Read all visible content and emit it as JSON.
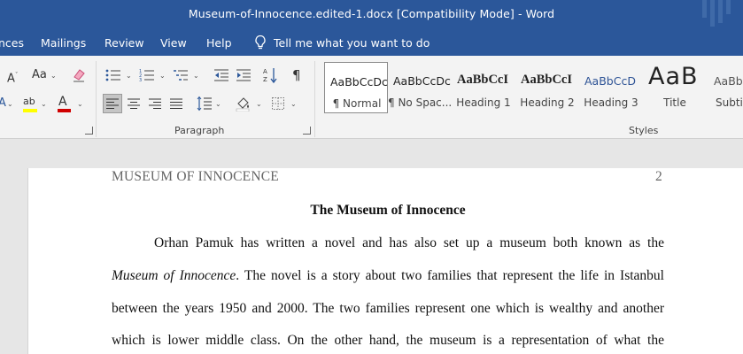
{
  "window": {
    "title": "Museum-of-Innocence.edited-1.docx [Compatibility Mode]  -  Word"
  },
  "menu": {
    "tabs": [
      "nces",
      "Mailings",
      "Review",
      "View",
      "Help"
    ],
    "tell_me": "Tell me what you want to do"
  },
  "ribbon": {
    "font_group": {
      "change_case": "Aa",
      "font_color_letter": "A",
      "highlight_letters": "ab"
    },
    "paragraph_label": "Paragraph",
    "styles_label": "Styles",
    "styles": [
      {
        "sample": "AaBbCcDc",
        "name": "¶ Normal"
      },
      {
        "sample": "AaBbCcDc",
        "name": "¶ No Spac..."
      },
      {
        "sample": "AaBbCcI",
        "name": "Heading 1"
      },
      {
        "sample": "AaBbCcI",
        "name": "Heading 2"
      },
      {
        "sample": "AaBbCcD",
        "name": "Heading 3"
      },
      {
        "sample": "AaB",
        "name": "Title"
      },
      {
        "sample": "AaBb",
        "name": "Subti"
      }
    ]
  },
  "document": {
    "header_left": "MUSEUM OF INNOCENCE",
    "page_number": "2",
    "title": "The Museum of Innocence",
    "lines": [
      {
        "text": "Orhan Pamuk has written a novel and has also set up a museum both known as the"
      },
      {
        "italic": "Museum of Innocence",
        "text": ". The novel is a story about two families that represent the life in Istanbul"
      },
      {
        "text": "between the years 1950 and 2000. The two families represent one which is wealthy and another"
      },
      {
        "text": "which is lower middle class. On the other hand, the museum is a representation of what the"
      }
    ]
  },
  "colors": {
    "title_bar": "#2b579a",
    "ribbon_bg": "#f3f3f3",
    "font_color_red": "#d00000",
    "highlight_yellow": "#ffff00",
    "heading3_blue": "#2f5496"
  }
}
